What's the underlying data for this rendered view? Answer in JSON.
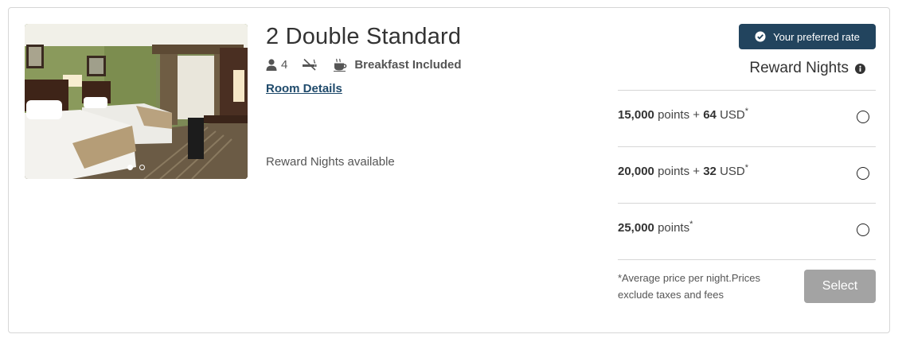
{
  "room": {
    "title": "2 Double Standard",
    "occupancy": "4",
    "breakfast": "Breakfast Included",
    "details_link": "Room Details",
    "availability": "Reward Nights available",
    "photo_count": 2,
    "photo_active_index": 1
  },
  "badge": {
    "label": "Your preferred rate",
    "color": "#22445e"
  },
  "rates_section": {
    "title": "Reward Nights",
    "rates": [
      {
        "points": "15,000",
        "points_word": "points",
        "plus": "+",
        "cash": "64",
        "currency": "USD",
        "asterisk": "*"
      },
      {
        "points": "20,000",
        "points_word": "points",
        "plus": "+",
        "cash": "32",
        "currency": "USD",
        "asterisk": "*"
      },
      {
        "points": "25,000",
        "points_word": "points",
        "asterisk": "*"
      }
    ]
  },
  "footnote": "*Average price per night.Prices exclude taxes and fees",
  "select_label": "Select",
  "icons": {
    "occupancy": "person-icon",
    "non_smoking": "no-smoking-icon",
    "breakfast": "coffee-cup-icon",
    "badge": "check-circle-icon",
    "info": "info-icon"
  }
}
